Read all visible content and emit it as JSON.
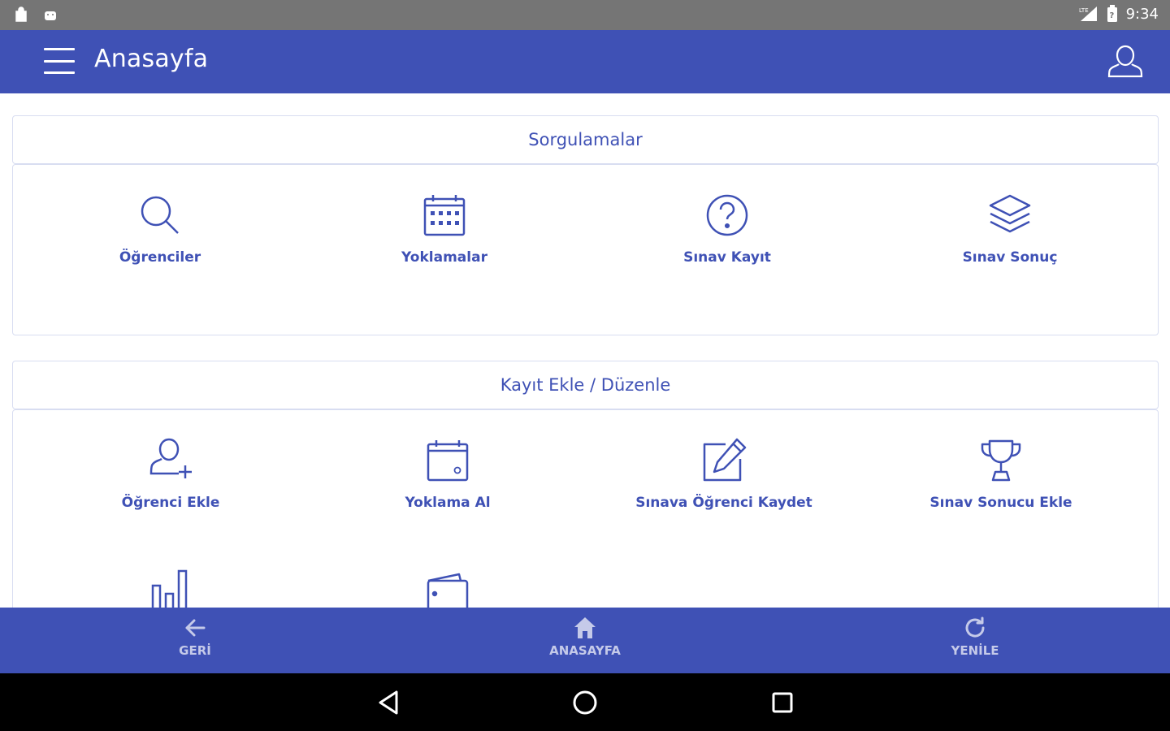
{
  "status_bar": {
    "time": "9:34",
    "network": "LTE",
    "battery_indicator": "battery-icon"
  },
  "app_bar": {
    "title": "Anasayfa",
    "menu_icon": "hamburger-menu-icon",
    "profile_icon": "user-icon"
  },
  "sections": [
    {
      "title": "Sorgulamalar",
      "items": [
        {
          "label": "Öğrenciler",
          "icon": "search-icon"
        },
        {
          "label": "Yoklamalar",
          "icon": "calendar-grid-icon"
        },
        {
          "label": "Sınav Kayıt",
          "icon": "question-circle-icon"
        },
        {
          "label": "Sınav Sonuç",
          "icon": "layers-icon"
        }
      ]
    },
    {
      "title": "Kayıt Ekle / Düzenle",
      "items": [
        {
          "label": "Öğrenci Ekle",
          "icon": "user-add-icon"
        },
        {
          "label": "Yoklama Al",
          "icon": "calendar-icon"
        },
        {
          "label": "Sınava Öğrenci Kaydet",
          "icon": "edit-icon"
        },
        {
          "label": "Sınav Sonucu Ekle",
          "icon": "trophy-icon"
        },
        {
          "label": "",
          "icon": "bar-chart-icon"
        },
        {
          "label": "",
          "icon": "wallet-icon"
        }
      ]
    }
  ],
  "bottom_nav": [
    {
      "label": "GERİ",
      "icon": "arrow-left-icon"
    },
    {
      "label": "ANASAYFA",
      "icon": "home-icon"
    },
    {
      "label": "YENİLE",
      "icon": "refresh-icon"
    }
  ],
  "colors": {
    "primary": "#3f51b5",
    "status_bar": "#757575",
    "border": "#d8ddf1",
    "nav_label": "#c5cae9"
  }
}
